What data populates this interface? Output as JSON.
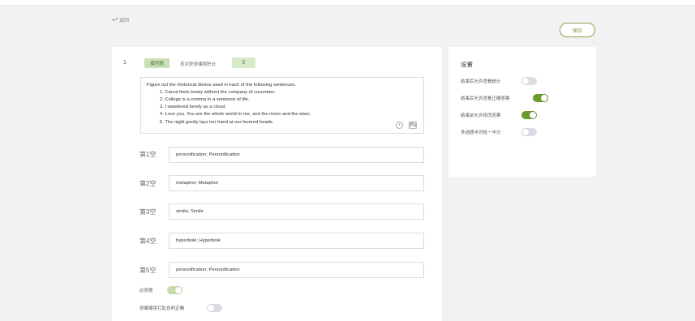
{
  "nav": {
    "back_label": "返回"
  },
  "toolbar": {
    "save_label": "保存"
  },
  "question": {
    "number": "1",
    "type_label": "填空题",
    "score_label": "答对获得课程积分",
    "score_value": "5",
    "lines": [
      "Figure out the rhetorical device used in each of the following sentences.",
      "1.  Carrot feels lonely without the company of cucumber.",
      "2. College is a comma in a sentence of life.",
      "3. I wandered lonely as a cloud.",
      "4. Love you. You are the whole world to me, and the moon and the stars.",
      "5. The night gently lays her hand at our fevered heads."
    ]
  },
  "blanks": [
    {
      "label": "第1空",
      "value": "personification; Personification"
    },
    {
      "label": "第2空",
      "value": "metaphor; Metaphor"
    },
    {
      "label": "第3空",
      "value": "simile; Simile"
    },
    {
      "label": "第4空",
      "value": "hyperbole; Hyperbole"
    },
    {
      "label": "第5空",
      "value": "personification; Personification"
    }
  ],
  "question_options": [
    {
      "label": "必答题",
      "state": "on-light"
    },
    {
      "label": "答案顺序打乱也判正确",
      "state": "off"
    }
  ],
  "settings": {
    "title": "设置",
    "items": [
      {
        "label": "结束后允许查看统计",
        "state": "off"
      },
      {
        "label": "结束后允许查看正确答案",
        "state": "on"
      },
      {
        "label": "结束前允许修改答案",
        "state": "on"
      },
      {
        "label": "多选题半对给一半分",
        "state": "off"
      }
    ]
  },
  "colors": {
    "accent": "#6a9a2e",
    "accent_light": "#c9e0b6",
    "toggle_off": "#dadde3"
  }
}
